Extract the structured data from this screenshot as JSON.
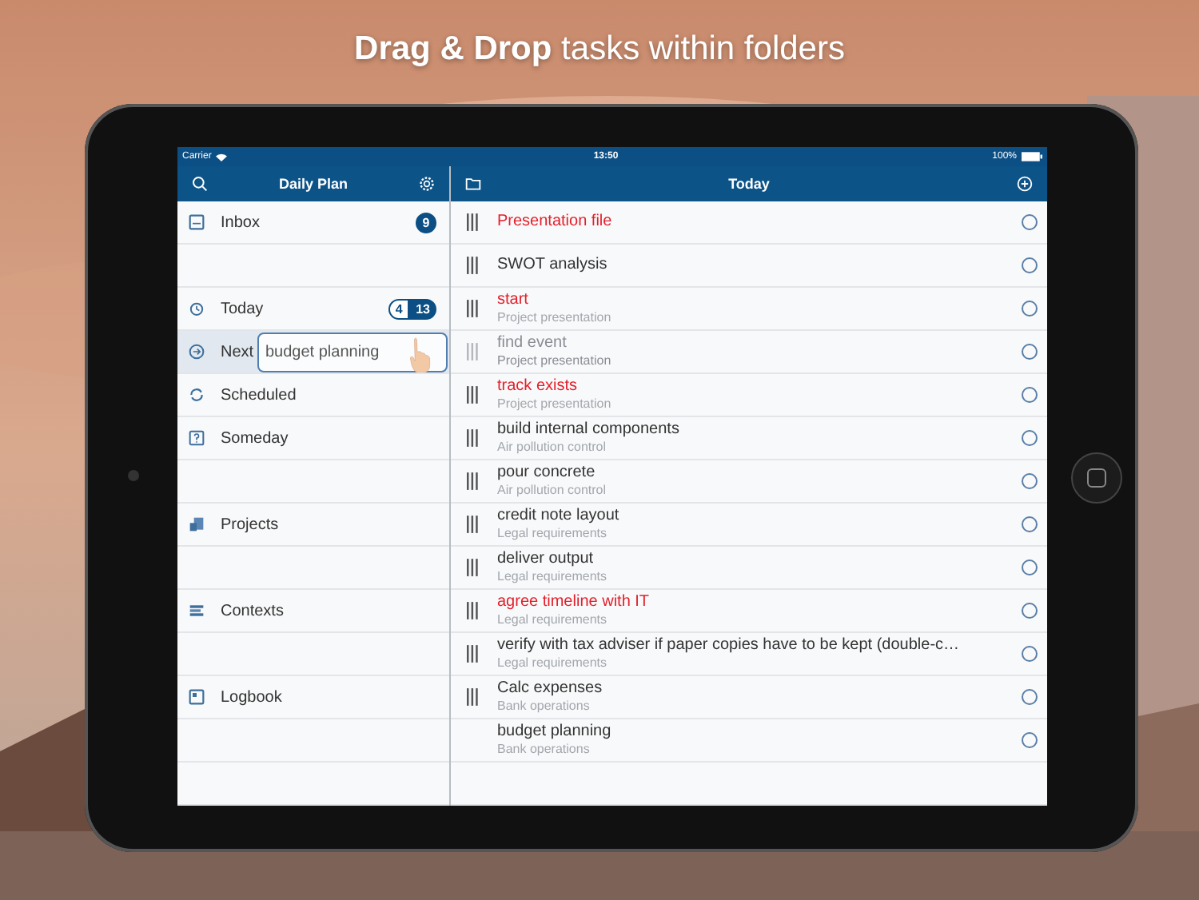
{
  "headline": "**Drag & Drop** tasks within folders",
  "status_bar": {
    "carrier": "Carrier",
    "time": "13:50",
    "battery": "100%"
  },
  "sidebar": {
    "title": "Daily Plan",
    "groups": [
      [
        {
          "label": "Inbox",
          "selected": false,
          "badges": [
            {
              "text": "9",
              "kind": "filled"
            }
          ]
        }
      ],
      [
        {
          "label": "Today",
          "selected": false,
          "badges": [
            {
              "text": "4",
              "kind": "outline"
            },
            {
              "text": "13",
              "kind": "filled"
            }
          ]
        },
        {
          "label": "Next",
          "selected": true,
          "drag_item": "budget planning"
        },
        {
          "label": "Scheduled",
          "selected": false
        },
        {
          "label": "Someday",
          "selected": false
        }
      ],
      [
        {
          "label": "Projects",
          "selected": false
        }
      ],
      [
        {
          "label": "Contexts",
          "selected": false
        }
      ],
      [
        {
          "label": "Logbook",
          "selected": false
        }
      ]
    ]
  },
  "tasks": {
    "title": "Today",
    "rows": [
      {
        "title": "Presentation file",
        "overdue": true,
        "handle": true,
        "dragging": false,
        "checked": false
      },
      {
        "title": "SWOT analysis",
        "overdue": false,
        "handle": true,
        "dragging": false,
        "checked": false
      },
      {
        "title": "start",
        "project": "Project presentation",
        "overdue": true,
        "handle": true,
        "dragging": false,
        "checked": false
      },
      {
        "title": "find event",
        "project": "Project presentation",
        "overdue": false,
        "handle": true,
        "dragging": true,
        "checked": false
      },
      {
        "title": "track exists",
        "project": "Project presentation",
        "overdue": true,
        "handle": true,
        "dragging": false,
        "checked": false
      },
      {
        "title": "build internal components",
        "project": "Air pollution control",
        "overdue": false,
        "handle": true,
        "dragging": false,
        "checked": false
      },
      {
        "title": "pour concrete",
        "project": "Air pollution control",
        "overdue": false,
        "handle": true,
        "dragging": false,
        "checked": false
      },
      {
        "title": "credit note layout",
        "project": "Legal requirements",
        "overdue": false,
        "handle": true,
        "dragging": false,
        "checked": false
      },
      {
        "title": "deliver output",
        "project": "Legal requirements",
        "overdue": false,
        "handle": true,
        "dragging": false,
        "checked": false
      },
      {
        "title": "agree timeline with IT",
        "project": "Legal requirements",
        "overdue": true,
        "handle": true,
        "dragging": false,
        "checked": false
      },
      {
        "title": "verify with tax adviser if paper copies have to be kept (double-c…",
        "project": "Legal requirements",
        "overdue": false,
        "handle": true,
        "dragging": false,
        "checked": false
      },
      {
        "title": "Calc expenses",
        "project": "Bank operations",
        "overdue": false,
        "handle": true,
        "dragging": false,
        "checked": false
      },
      {
        "title": "budget planning",
        "project": "Bank operations",
        "overdue": false,
        "handle": false,
        "dragging": false,
        "checked": false
      }
    ]
  }
}
